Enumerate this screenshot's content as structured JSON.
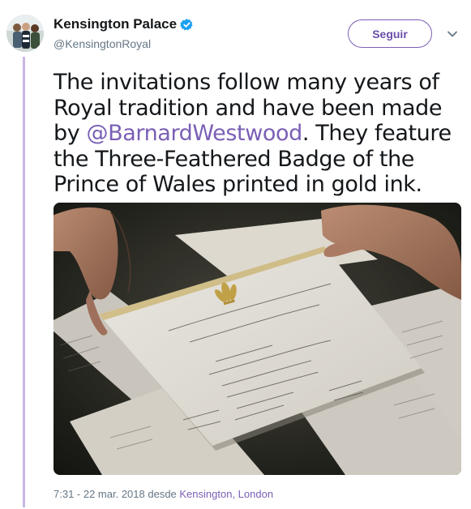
{
  "author": {
    "display_name": "Kensington Palace",
    "handle": "@KensingtonRoyal",
    "verified": true,
    "avatar_icon": "profile-photo"
  },
  "actions": {
    "follow_label": "Seguir",
    "more_icon": "chevron-down-icon"
  },
  "tweet": {
    "text_before_mention": "The invitations follow many years of Royal tradition and have been made by ",
    "mention": "@BarnardWestwood",
    "text_after_mention": ". They feature the Three-Feathered Badge of the Prince of Wales printed in gold ink.",
    "photo_icon": "wedding-invitations-photo"
  },
  "footer": {
    "timestamp": "7:31 - 22 mar. 2018 desde ",
    "location": "Kensington, London"
  },
  "colors": {
    "accent": "#7a5fb5",
    "thread_line": "#c7b6e6",
    "verified": "#1da1f2",
    "text_primary": "#14171a",
    "text_secondary": "#657786"
  }
}
